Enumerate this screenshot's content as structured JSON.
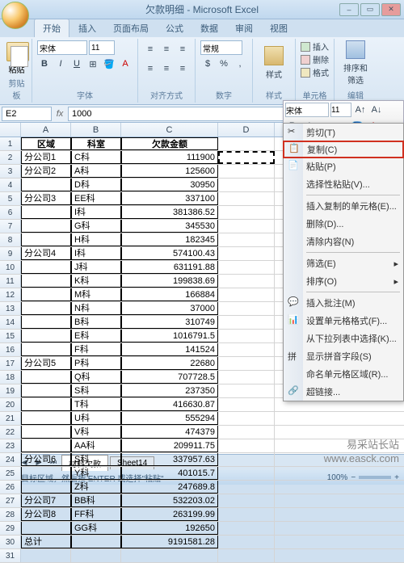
{
  "window": {
    "title": "欠款明细 - Microsoft Excel"
  },
  "tabs": {
    "items": [
      "开始",
      "插入",
      "页面布局",
      "公式",
      "数据",
      "审阅",
      "视图"
    ],
    "active": 0
  },
  "ribbon": {
    "clipboard": {
      "paste": "粘贴",
      "label": "剪贴板"
    },
    "font": {
      "family": "宋体",
      "size": "11",
      "label": "字体"
    },
    "align": {
      "label": "对齐方式"
    },
    "number": {
      "format": "常规",
      "label": "数字"
    },
    "style": {
      "btn": "样式",
      "label": "样式"
    },
    "cells": {
      "insert": "插入",
      "delete": "删除",
      "format": "格式",
      "label": "单元格"
    },
    "edit": {
      "sort": "排序和\n筛选",
      "label": "编辑"
    }
  },
  "formula": {
    "name": "E2",
    "value": "1000"
  },
  "columns": [
    "A",
    "B",
    "C",
    "D"
  ],
  "headers": {
    "a": "区域",
    "b": "科室",
    "c": "欠款金额"
  },
  "data": [
    {
      "r": 2,
      "a": "分公司1",
      "b": "C科",
      "c": "111900"
    },
    {
      "r": 3,
      "a": "分公司2",
      "b": "A科",
      "c": "125600"
    },
    {
      "r": 4,
      "a": "",
      "b": "D科",
      "c": "30950"
    },
    {
      "r": 5,
      "a": "分公司3",
      "b": "EE科",
      "c": "337100"
    },
    {
      "r": 6,
      "a": "",
      "b": "I科",
      "c": "381386.52"
    },
    {
      "r": 7,
      "a": "",
      "b": "G科",
      "c": "345530"
    },
    {
      "r": 8,
      "a": "",
      "b": "H科",
      "c": "182345"
    },
    {
      "r": 9,
      "a": "分公司4",
      "b": "I科",
      "c": "574100.43"
    },
    {
      "r": 10,
      "a": "",
      "b": "J科",
      "c": "631191.88"
    },
    {
      "r": 11,
      "a": "",
      "b": "K科",
      "c": "199838.69"
    },
    {
      "r": 12,
      "a": "",
      "b": "M科",
      "c": "166884"
    },
    {
      "r": 13,
      "a": "",
      "b": "N科",
      "c": "37000"
    },
    {
      "r": 14,
      "a": "",
      "b": "B科",
      "c": "310749"
    },
    {
      "r": 15,
      "a": "",
      "b": "E科",
      "c": "1016791.5"
    },
    {
      "r": 16,
      "a": "",
      "b": "F科",
      "c": "141524"
    },
    {
      "r": 17,
      "a": "分公司5",
      "b": "P科",
      "c": "22680"
    },
    {
      "r": 18,
      "a": "",
      "b": "Q科",
      "c": "707728.5"
    },
    {
      "r": 19,
      "a": "",
      "b": "S科",
      "c": "237350"
    },
    {
      "r": 20,
      "a": "",
      "b": "T科",
      "c": "416630.87"
    },
    {
      "r": 21,
      "a": "",
      "b": "U科",
      "c": "555294"
    },
    {
      "r": 22,
      "a": "",
      "b": "V科",
      "c": "474379"
    },
    {
      "r": 23,
      "a": "",
      "b": "AA科",
      "c": "209911.75"
    },
    {
      "r": 24,
      "a": "分公司6",
      "b": "S科",
      "c": "337957.63"
    },
    {
      "r": 25,
      "a": "",
      "b": "Y科",
      "c": "401015.7"
    },
    {
      "r": 26,
      "a": "",
      "b": "Z科",
      "c": "247689.8"
    },
    {
      "r": 27,
      "a": "分公司7",
      "b": "BB科",
      "c": "532203.02"
    },
    {
      "r": 28,
      "a": "分公司8",
      "b": "FF科",
      "c": "263199.99"
    },
    {
      "r": 29,
      "a": "",
      "b": "GG科",
      "c": "192650"
    },
    {
      "r": 30,
      "a": "总计",
      "b": "",
      "c": "9191581.28"
    }
  ],
  "mini": {
    "font": "宋体",
    "size": "11"
  },
  "context": {
    "cut": "剪切(T)",
    "copy": "复制(C)",
    "paste": "粘贴(P)",
    "pspecial": "选择性粘贴(V)...",
    "insertcopied": "插入复制的单元格(E)...",
    "delete": "删除(D)...",
    "clear": "清除内容(N)",
    "filter": "筛选(E)",
    "sort": "排序(O)",
    "comment": "插入批注(M)",
    "format": "设置单元格格式(F)...",
    "picklist": "从下拉列表中选择(K)...",
    "phonetic": "显示拼音字段(S)",
    "namerange": "命名单元格区域(R)...",
    "hyperlink": "超链接..."
  },
  "sheets": {
    "tabs": [
      "材料欠款",
      "Sheet14"
    ],
    "active": 0
  },
  "status": {
    "msg": "选定目标区域，然后按 ENTER 或选择\"粘贴\"",
    "zoom": "100%"
  },
  "watermark": {
    "l1": "易采站长站",
    "l2": "www.easck.com"
  }
}
